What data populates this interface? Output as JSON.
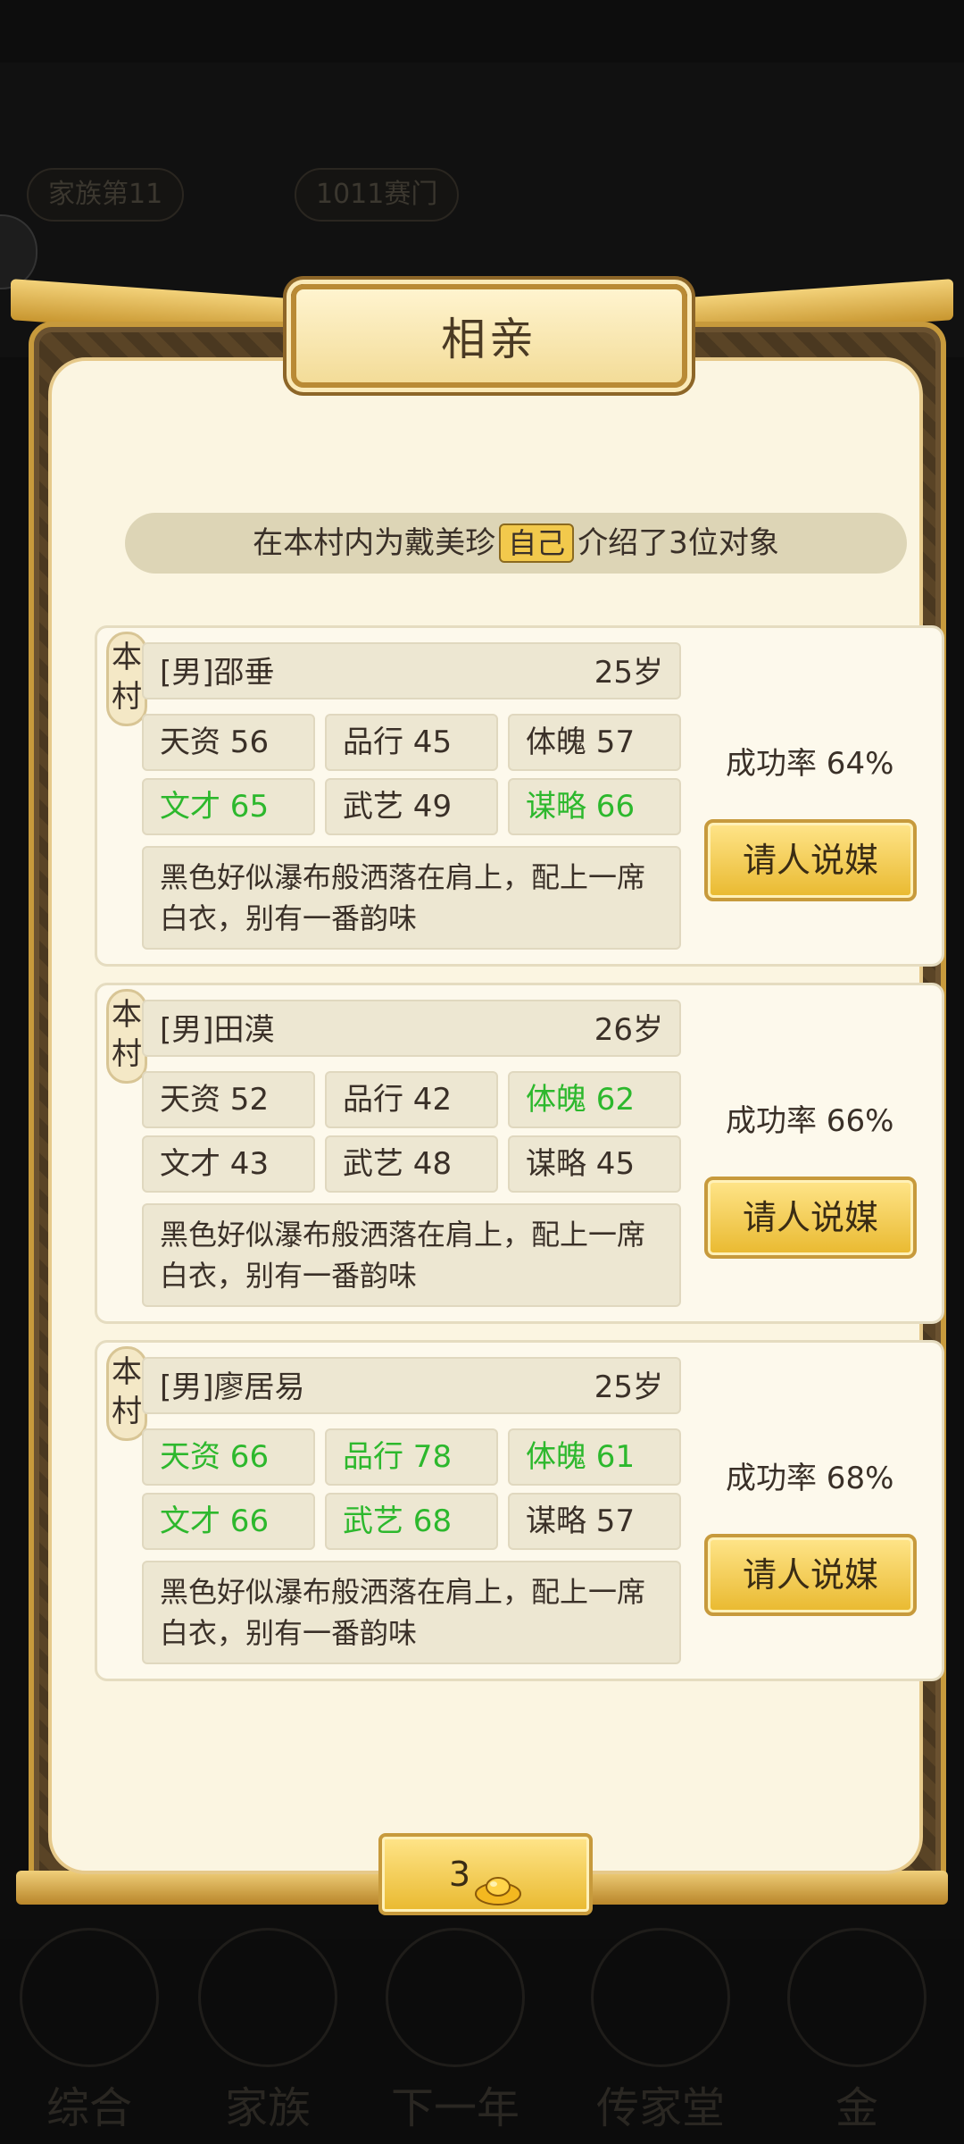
{
  "background": {
    "top_pills": [
      "家族第11",
      "1011赛门"
    ],
    "bottom_nav": [
      "综合",
      "家族",
      "下一年",
      "传家堂",
      "金"
    ]
  },
  "modal": {
    "title": "相亲",
    "intro_prefix": "在本村内为戴美珍",
    "intro_self": "自己",
    "intro_suffix": "介绍了3位对象",
    "candidates": [
      {
        "tag": "本村",
        "name": "[男]邵垂",
        "age": "25岁",
        "stats": [
          {
            "label": "天资 56",
            "highlight": false
          },
          {
            "label": "品行 45",
            "highlight": false
          },
          {
            "label": "体魄 57",
            "highlight": false
          },
          {
            "label": "文才 65",
            "highlight": true
          },
          {
            "label": "武艺 49",
            "highlight": false
          },
          {
            "label": "谋略 66",
            "highlight": true
          }
        ],
        "desc": "黑色好似瀑布般洒落在肩上，配上一席白衣，别有一番韵味",
        "success_rate": "成功率 64%",
        "button": "请人说媒"
      },
      {
        "tag": "本村",
        "name": "[男]田漠",
        "age": "26岁",
        "stats": [
          {
            "label": "天资 52",
            "highlight": false
          },
          {
            "label": "品行 42",
            "highlight": false
          },
          {
            "label": "体魄 62",
            "highlight": true
          },
          {
            "label": "文才 43",
            "highlight": false
          },
          {
            "label": "武艺 48",
            "highlight": false
          },
          {
            "label": "谋略 45",
            "highlight": false
          }
        ],
        "desc": "黑色好似瀑布般洒落在肩上，配上一席白衣，别有一番韵味",
        "success_rate": "成功率 66%",
        "button": "请人说媒"
      },
      {
        "tag": "本村",
        "name": "[男]廖居易",
        "age": "25岁",
        "stats": [
          {
            "label": "天资 66",
            "highlight": true
          },
          {
            "label": "品行 78",
            "highlight": true
          },
          {
            "label": "体魄 61",
            "highlight": true
          },
          {
            "label": "文才 66",
            "highlight": true
          },
          {
            "label": "武艺 68",
            "highlight": true
          },
          {
            "label": "谋略 57",
            "highlight": false
          }
        ],
        "desc": "黑色好似瀑布般洒落在肩上，配上一席白衣，别有一番韵味",
        "success_rate": "成功率 68%",
        "button": "请人说媒"
      }
    ],
    "refresh_cost": "3",
    "refresh_icon": "gold-ingot-icon"
  },
  "colors": {
    "highlight_green": "#2db82d",
    "gold_button": "#e9b92f",
    "panel_bg": "#fbf5e1"
  }
}
